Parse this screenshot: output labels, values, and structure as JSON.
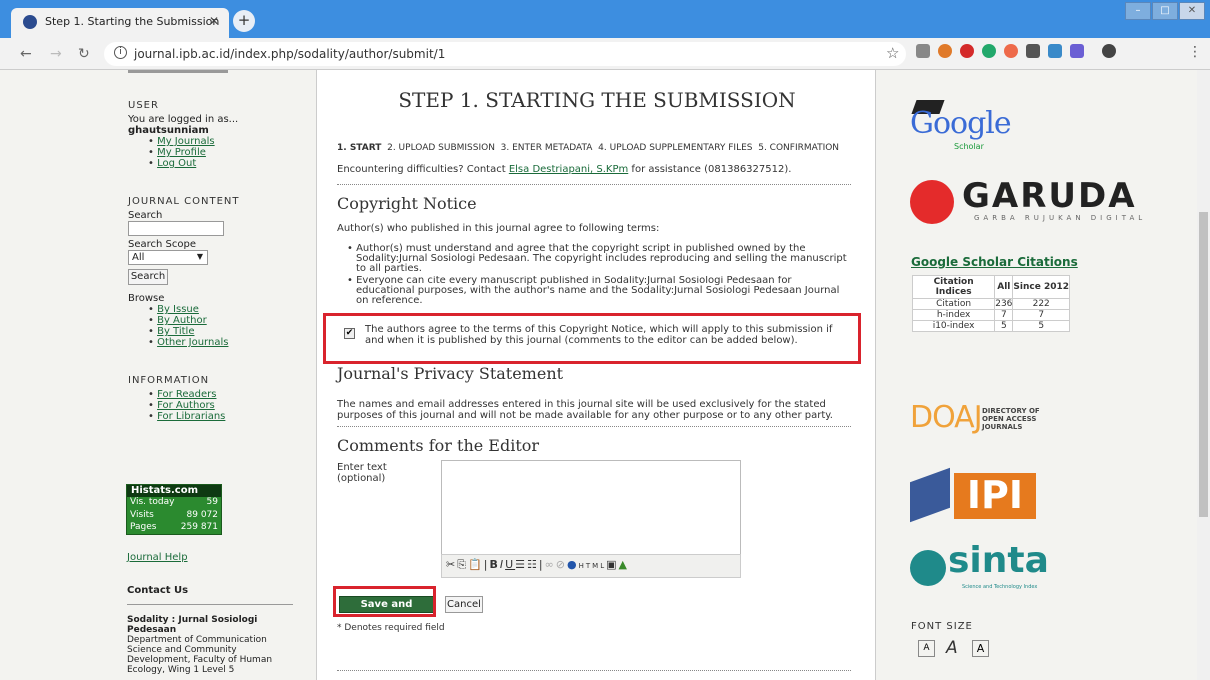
{
  "browser": {
    "tab_title": "Step 1. Starting the Submission",
    "url": "journal.ipb.ac.id/index.php/sodality/author/submit/1"
  },
  "left": {
    "user_title": "USER",
    "logged_in": "You are logged in as...",
    "username": "ghautsunniam",
    "user_links": [
      "My Journals",
      "My Profile",
      "Log Out"
    ],
    "content_title": "JOURNAL CONTENT",
    "search_label": "Search",
    "scope_label": "Search Scope",
    "scope_value": "All",
    "search_button": "Search",
    "browse_label": "Browse",
    "browse_links": [
      "By Issue",
      "By Author",
      "By Title",
      "Other Journals"
    ],
    "info_title": "INFORMATION",
    "info_links": [
      "For Readers",
      "For Authors",
      "For Librarians"
    ],
    "histats": {
      "logo": "Histats.com",
      "rows": [
        [
          "Vis. today",
          "59"
        ],
        [
          "Visits",
          "89 072"
        ],
        [
          "Pages",
          "259 871"
        ]
      ]
    },
    "journal_help": "Journal Help",
    "contact_title": "Contact Us",
    "contact_name": "Sodality : Jurnal Sosiologi Pedesaan",
    "contact_lines": [
      "Department of Communication",
      "Science and Community",
      "Development, Faculty of Human",
      "Ecology, Wing 1 Level 5"
    ]
  },
  "main": {
    "title": "STEP 1. STARTING THE SUBMISSION",
    "steps": [
      "1. START",
      "2. UPLOAD SUBMISSION",
      "3. ENTER METADATA",
      "4. UPLOAD SUPPLEMENTARY FILES",
      "5. CONFIRMATION"
    ],
    "contact_pre": "Encountering difficulties? Contact ",
    "contact_name": "Elsa Destriapani, S.KPm",
    "contact_post": " for assistance (081386327512).",
    "copyright_title": "Copyright Notice",
    "copyright_intro": "Author(s) who published in this journal agree to following terms:",
    "bullet1": [
      "Author(s) must understand and agree that the copyright script in published owned by the",
      "Sodality:Jurnal Sosiologi Pedesaan. The copyright includes reproducing and selling the manuscript",
      "to all parties."
    ],
    "bullet2": [
      "Everyone can cite every manuscript published in Sodality:Jurnal Sosiologi Pedesaan for",
      "educational purposes, with the author's name and the Sodality:Jurnal Sosiologi Pedesaan Journal",
      "on reference."
    ],
    "agree_text": [
      "The authors agree to the terms of this Copyright Notice, which will apply to this submission if",
      "and when it is published by this journal (comments to the editor can be added below)."
    ],
    "privacy_title": "Journal's Privacy Statement",
    "privacy_text": [
      "The names and email addresses entered in this journal site will be used exclusively for the stated",
      "purposes of this journal and will not be made available for any other purpose or to any other party."
    ],
    "comments_title": "Comments for the Editor",
    "enter_text": "Enter text",
    "optional": "(optional)",
    "save_button": "Save and continue",
    "cancel_button": "Cancel",
    "required_note": "* Denotes required field"
  },
  "right": {
    "google": "Google",
    "scholar": "Scholar",
    "garuda": "GARUDA",
    "garuda_sub": "GARBA RUJUKAN DIGITAL",
    "gs_title": "Google Scholar Citations",
    "table_headers": [
      "Citation Indices",
      "All",
      "Since 2012"
    ],
    "table_rows": [
      [
        "Citation",
        "236",
        "222"
      ],
      [
        "h-index",
        "7",
        "7"
      ],
      [
        "i10-index",
        "5",
        "5"
      ]
    ],
    "doaj": "DOAJ",
    "doaj_sub": [
      "DIRECTORY OF",
      "OPEN ACCESS",
      "JOURNALS"
    ],
    "ipi": "IPI",
    "sinta": "sinta",
    "sinta_sub": "Science and Technology Index",
    "font_size": "FONT SIZE"
  }
}
